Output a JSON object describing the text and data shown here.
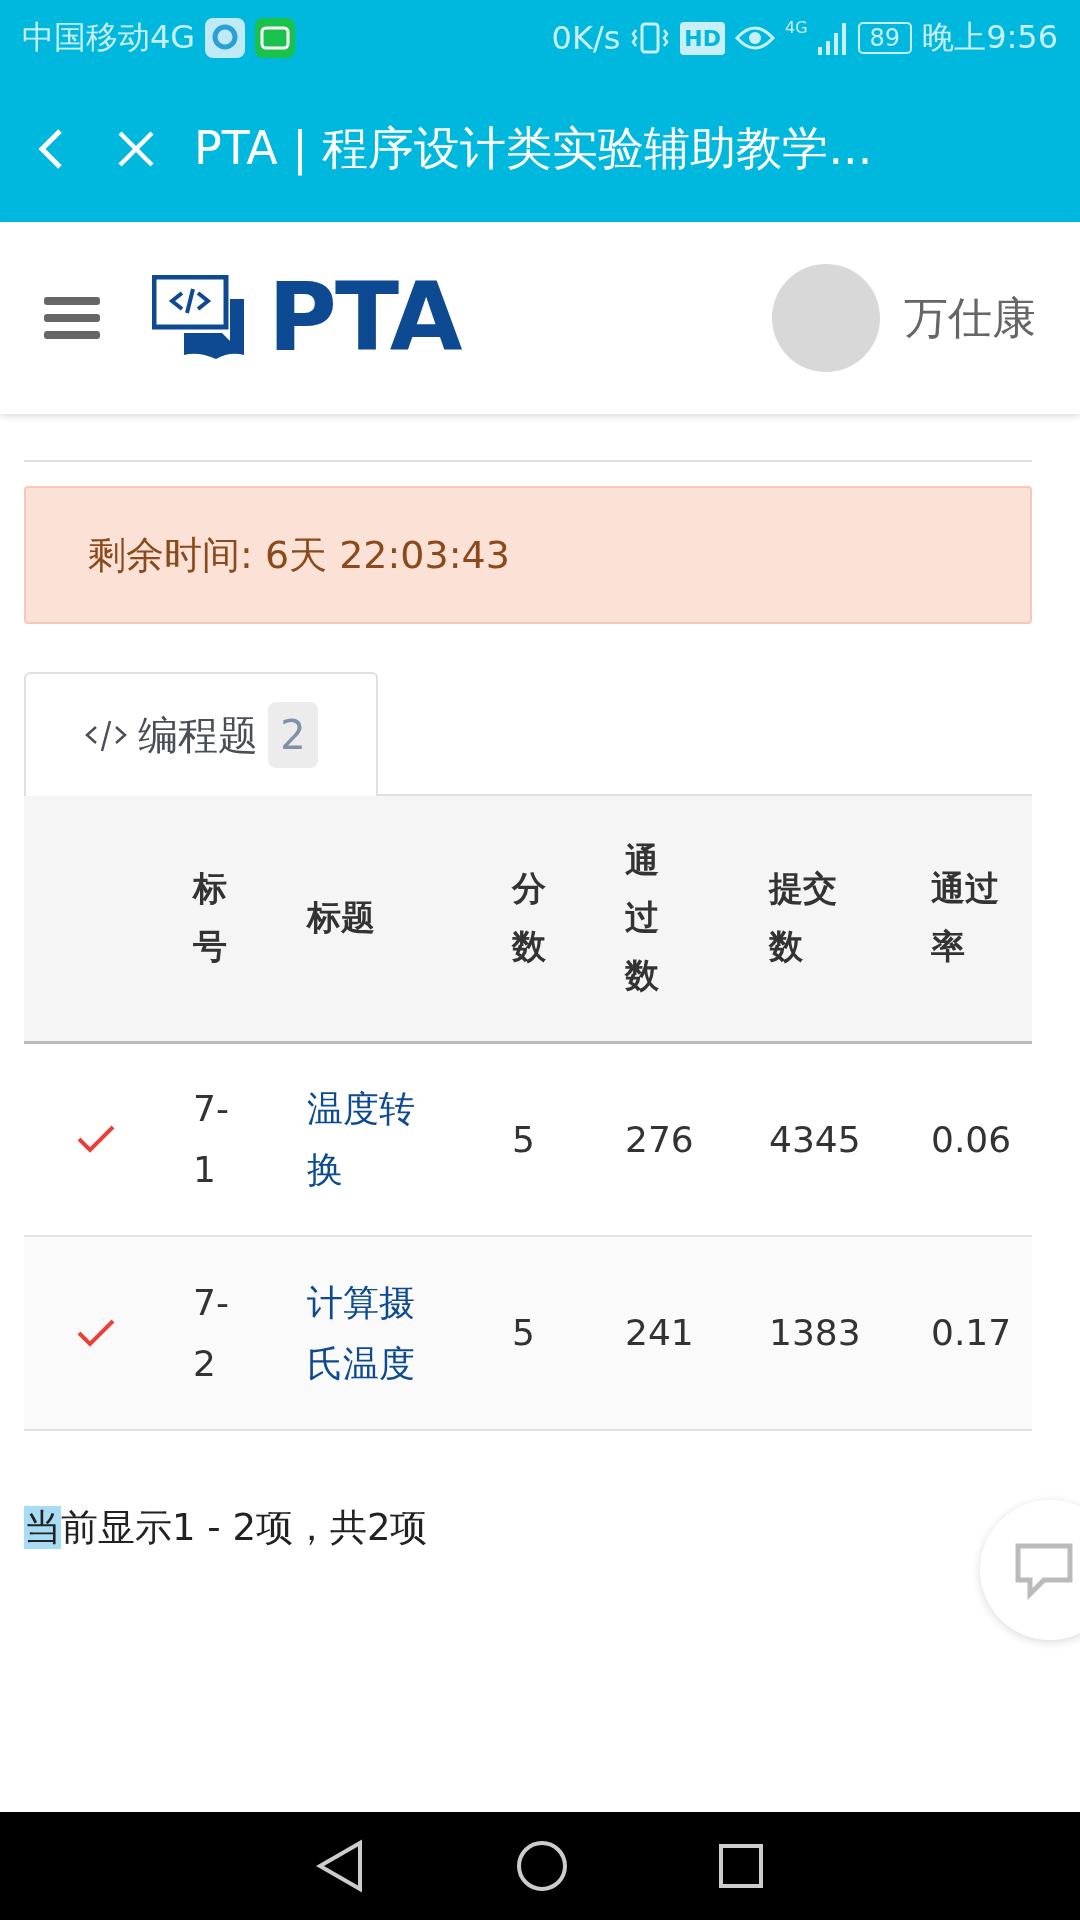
{
  "status_bar": {
    "carrier": "中国移动4G",
    "speed": "0K/s",
    "hd": "HD",
    "network": "4G",
    "battery": "89",
    "time": "晚上9:56"
  },
  "browser_bar": {
    "title": "PTA | 程序设计类实验辅助教学..."
  },
  "header": {
    "logo_text": "PTA",
    "user_name": "万仕康"
  },
  "alert": {
    "text": "剩余时间: 6天 22:03:43"
  },
  "tabs": [
    {
      "label": "编程题",
      "count": "2",
      "selected": true
    }
  ],
  "table": {
    "columns": [
      "",
      "标号",
      "标题",
      "分数",
      "通过数",
      "提交数",
      "通过率"
    ],
    "rows": [
      {
        "solved": true,
        "cells": [
          "",
          "7-1",
          "温度转换",
          "5",
          "276",
          "4345",
          "0.06"
        ]
      },
      {
        "solved": true,
        "cells": [
          "",
          "7-2",
          "计算摄氏温度",
          "5",
          "241",
          "1383",
          "0.17"
        ]
      }
    ]
  },
  "footer": {
    "parts": [
      {
        "text": "当",
        "selected": true
      },
      {
        "text": "前显示1 - 2项，共2项",
        "selected": false
      }
    ]
  }
}
